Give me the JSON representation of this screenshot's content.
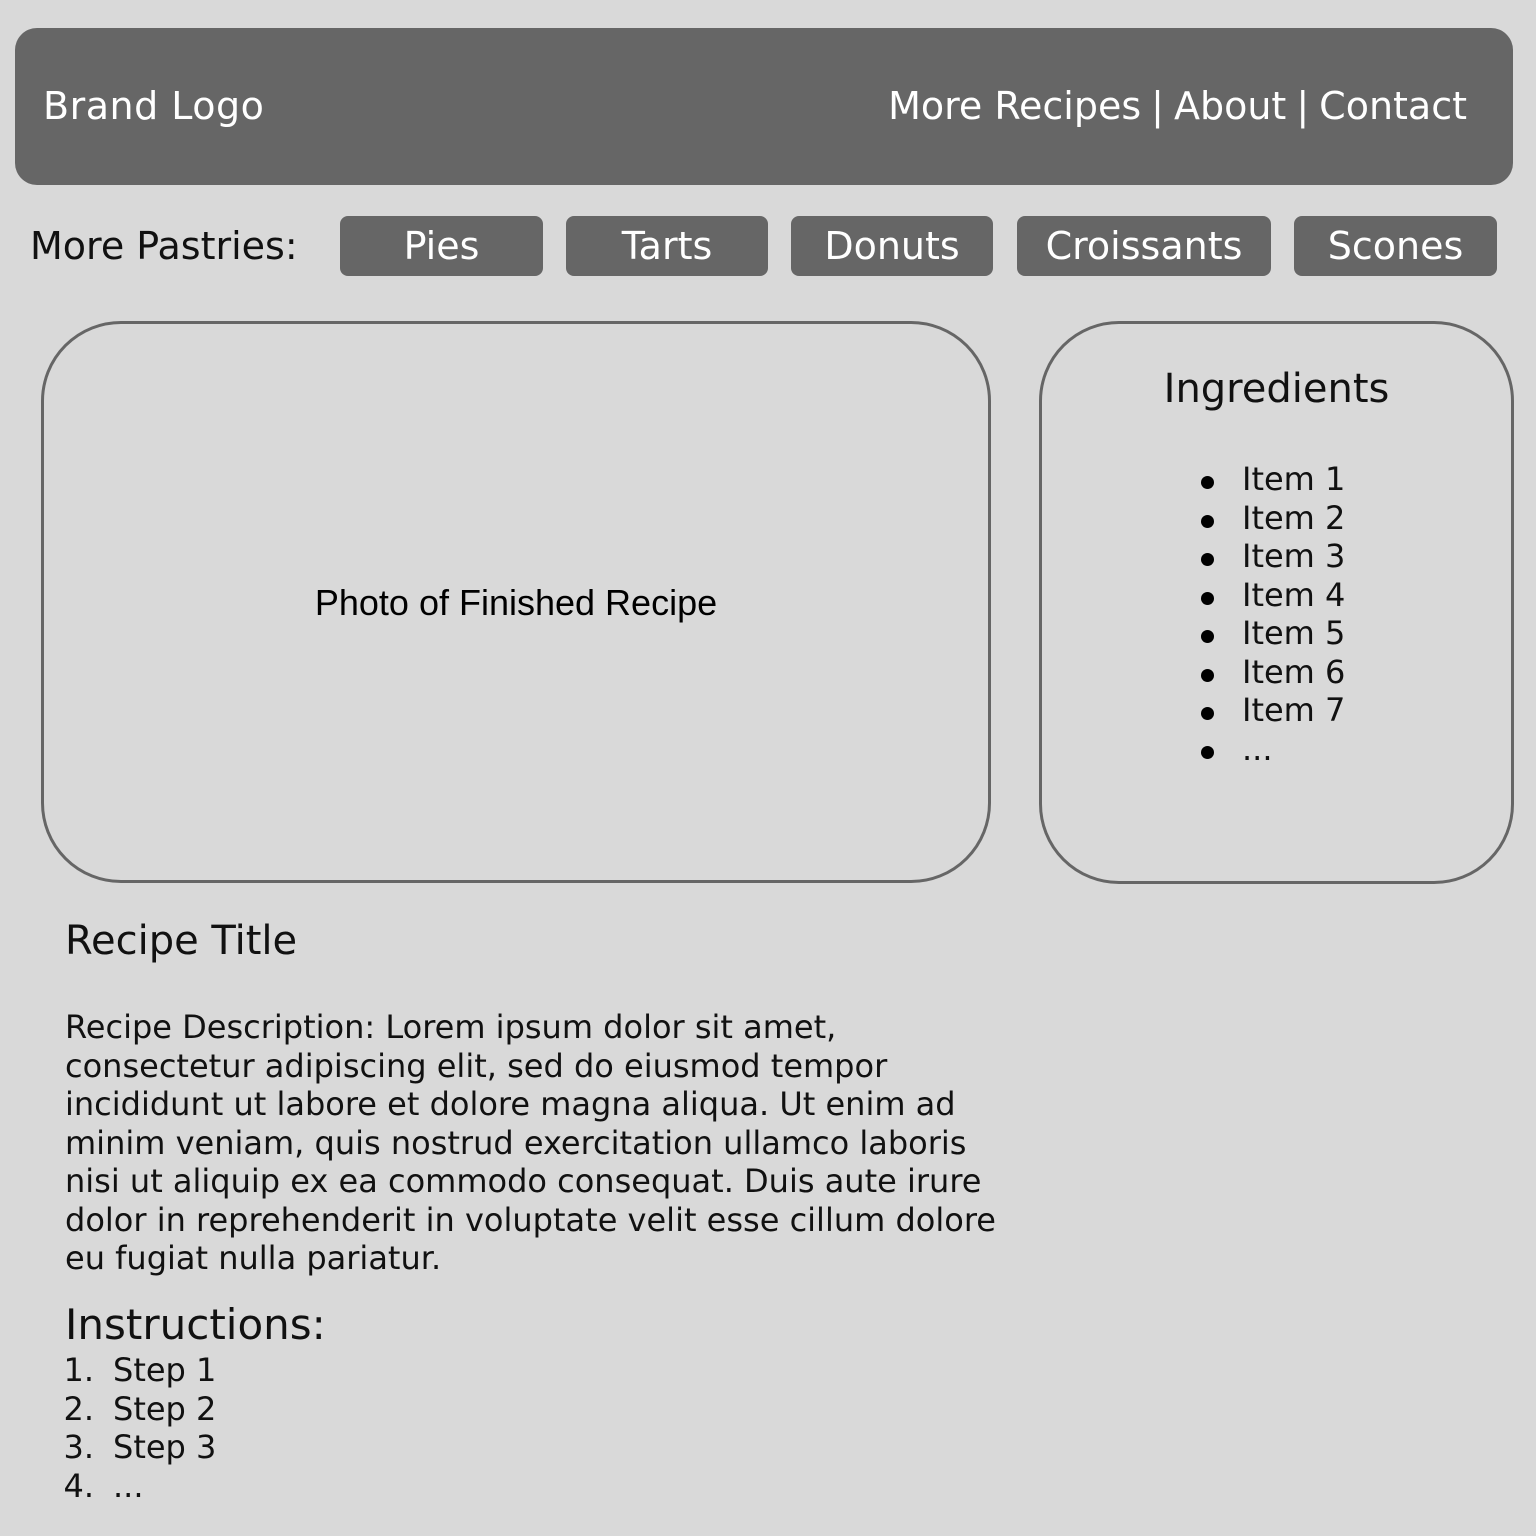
{
  "header": {
    "brand": "Brand Logo",
    "nav": {
      "more_recipes": "More Recipes",
      "about": "About",
      "contact": "Contact",
      "separator": "|"
    }
  },
  "pastries": {
    "label": "More Pastries:",
    "items": [
      "Pies",
      "Tarts",
      "Donuts",
      "Croissants",
      "Scones"
    ]
  },
  "photo": {
    "caption": "Photo of Finished Recipe"
  },
  "ingredients": {
    "title": "Ingredients",
    "items": [
      "Item 1",
      "Item 2",
      "Item 3",
      "Item 4",
      "Item 5",
      "Item 6",
      "Item 7",
      "..."
    ]
  },
  "recipe": {
    "title": "Recipe Title",
    "description": "Recipe Description: Lorem ipsum dolor sit amet, consectetur adipiscing elit, sed do eiusmod tempor incididunt ut labore et dolore magna aliqua. Ut enim ad minim veniam, quis nostrud exercitation ullamco laboris nisi ut aliquip ex ea commodo consequat. Duis aute irure dolor in reprehenderit in voluptate velit esse cillum dolore eu fugiat nulla pariatur."
  },
  "instructions": {
    "title": "Instructions:",
    "steps": [
      {
        "num": "1.",
        "text": "Step 1"
      },
      {
        "num": "2.",
        "text": "Step 2"
      },
      {
        "num": "3.",
        "text": "Step 3"
      },
      {
        "num": "4.",
        "text": "..."
      }
    ]
  },
  "colors": {
    "background": "#d9d9d9",
    "header_bg": "#666666",
    "pill_bg": "#666666",
    "border": "#666666",
    "text_dark": "#111111",
    "text_light": "#ffffff"
  }
}
